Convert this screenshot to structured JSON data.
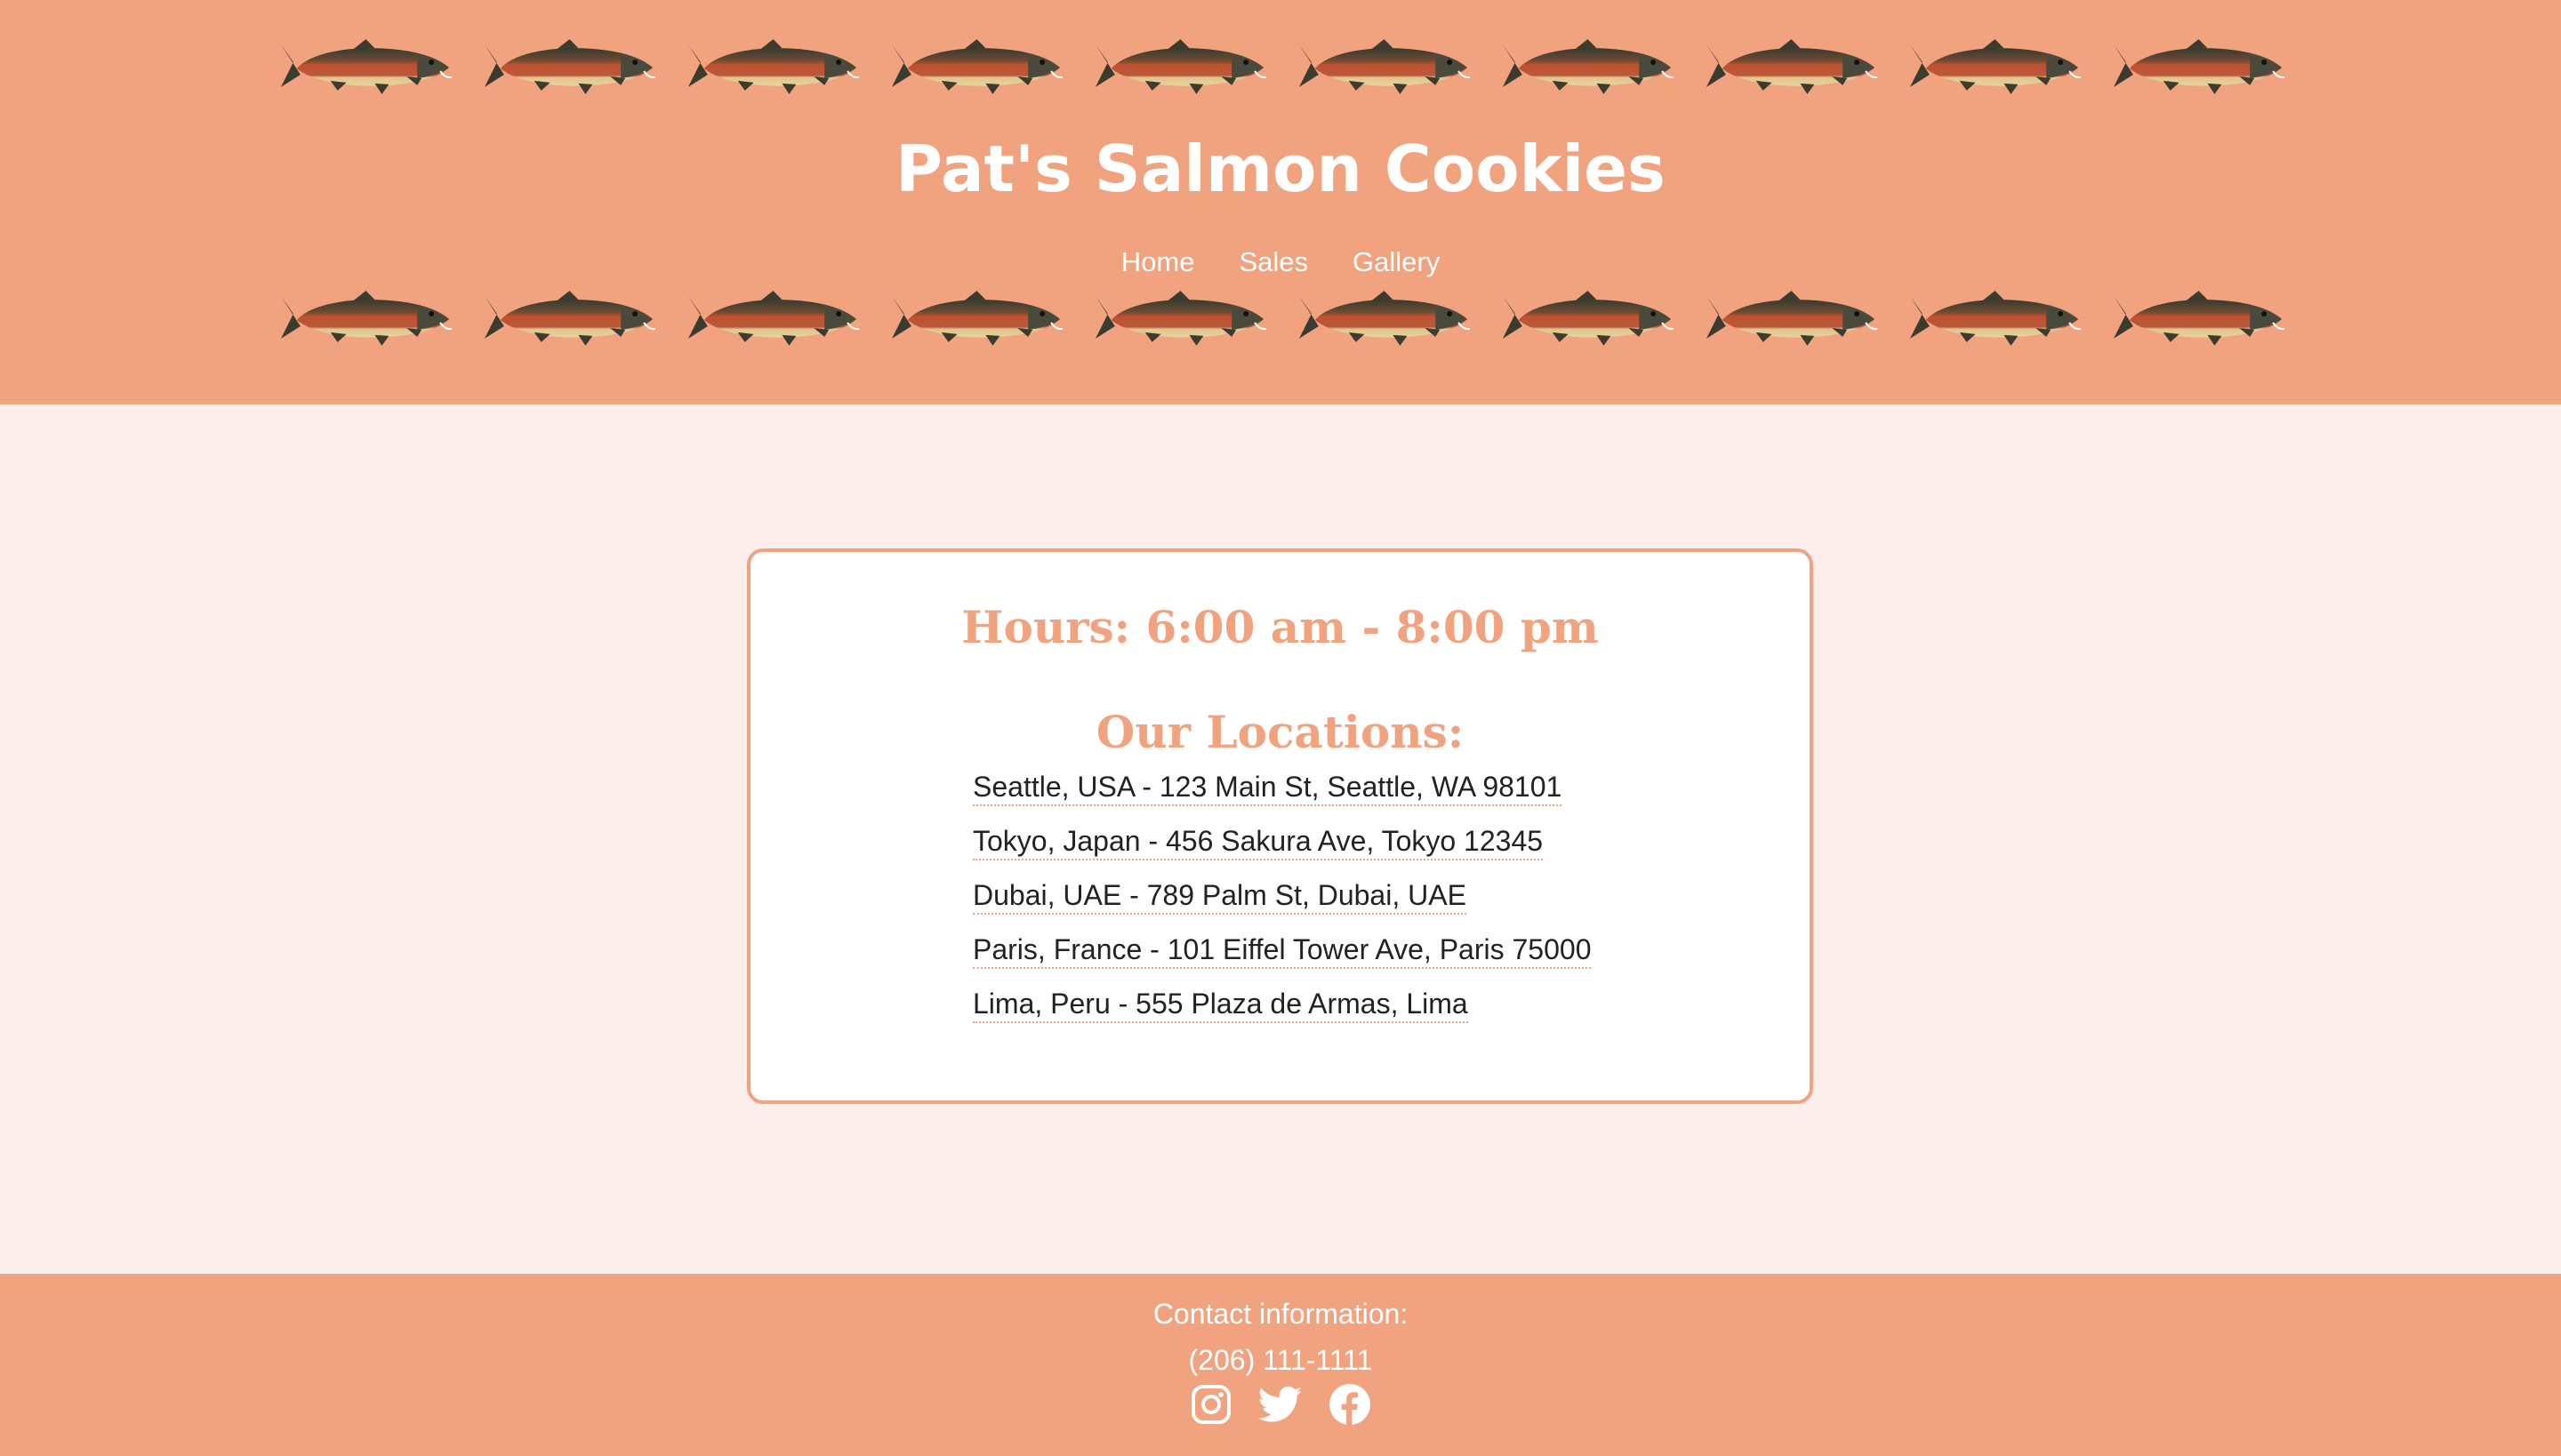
{
  "header": {
    "title": "Pat's Salmon Cookies",
    "fish_icon": "salmon-icon",
    "nav": [
      {
        "label": "Home"
      },
      {
        "label": "Sales"
      },
      {
        "label": "Gallery"
      }
    ]
  },
  "main": {
    "hours": "Hours: 6:00 am - 8:00 pm",
    "locations_heading": "Our Locations:",
    "locations": [
      "Seattle, USA - 123 Main St, Seattle, WA 98101",
      "Tokyo, Japan - 456 Sakura Ave, Tokyo 12345",
      "Dubai, UAE - 789 Palm St, Dubai, UAE",
      "Paris, France - 101 Eiffel Tower Ave, Paris 75000",
      "Lima, Peru - 555 Plaza de Armas, Lima"
    ]
  },
  "footer": {
    "contact_label": "Contact information:",
    "phone": "(206) 111-1111",
    "socials": [
      "instagram-icon",
      "twitter-icon",
      "facebook-icon"
    ]
  },
  "colors": {
    "salmon": "#f1a37f",
    "page_bg": "#fbeeeb",
    "card_bg": "#ffffff",
    "text_dark": "#222222"
  }
}
